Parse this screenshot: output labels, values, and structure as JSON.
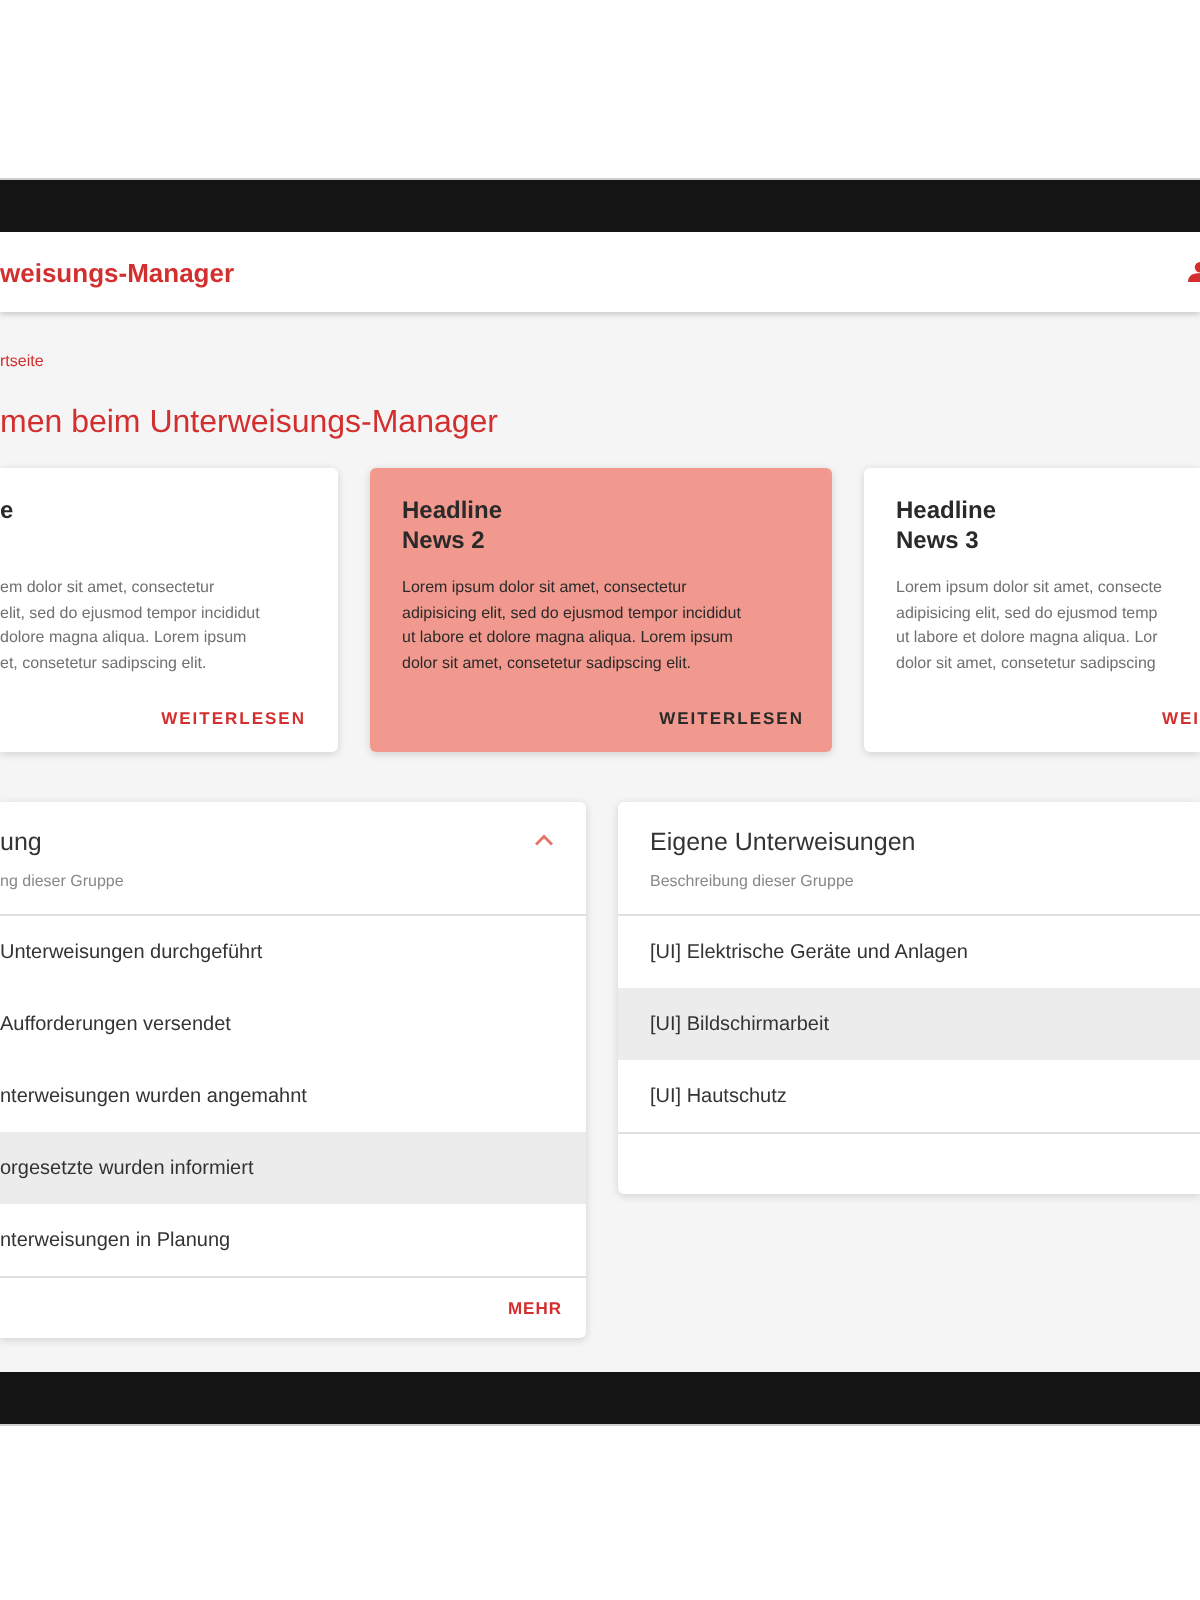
{
  "header": {
    "title": "weisungs-Manager"
  },
  "breadcrumb": "rtseite",
  "page_title": "men beim Unterweisungs-Manager",
  "news_cards": [
    {
      "headline_lines": [
        "e"
      ],
      "body_lines": [
        "em dolor sit amet, consectetur",
        "elit, sed do ejusmod tempor incididut",
        "dolore magna aliqua. Lorem ipsum",
        "et, consetetur sadipscing elit."
      ],
      "action": "WEITERLESEN",
      "highlighted": false
    },
    {
      "headline_lines": [
        "Headline",
        "News 2"
      ],
      "body_lines": [
        "Lorem ipsum dolor sit amet, consectetur",
        "adipisicing elit, sed do ejusmod tempor incididut",
        "ut labore et dolore magna aliqua. Lorem ipsum",
        "dolor sit amet, consetetur sadipscing elit."
      ],
      "action": "WEITERLESEN",
      "highlighted": true
    },
    {
      "headline_lines": [
        "Headline",
        "News 3"
      ],
      "body_lines": [
        "Lorem ipsum dolor sit amet, consecte",
        "adipisicing elit, sed do ejusmod temp",
        "ut labore et dolore magna aliqua. Lor",
        "dolor sit amet, consetetur sadipscing"
      ],
      "action": "WEI",
      "highlighted": false
    }
  ],
  "groups": [
    {
      "title": "ung",
      "subtitle": "ng dieser Gruppe",
      "expanded": true,
      "items": [
        {
          "label": "Unterweisungen durchgeführt",
          "selected": false
        },
        {
          "label": "Aufforderungen versendet",
          "selected": false
        },
        {
          "label": "nterweisungen wurden angemahnt",
          "selected": false
        },
        {
          "label": "orgesetzte wurden informiert",
          "selected": true
        },
        {
          "label": "nterweisungen in Planung",
          "selected": false
        }
      ],
      "footer_action": "MEHR"
    },
    {
      "title": "Eigene Unterweisungen",
      "subtitle": "Beschreibung dieser Gruppe",
      "items": [
        {
          "label": "[UI] Elektrische Geräte und Anlagen",
          "selected": false
        },
        {
          "label": "[UI] Bildschirmarbeit",
          "selected": true
        },
        {
          "label": "[UI] Hautschutz",
          "selected": false
        }
      ]
    }
  ]
}
